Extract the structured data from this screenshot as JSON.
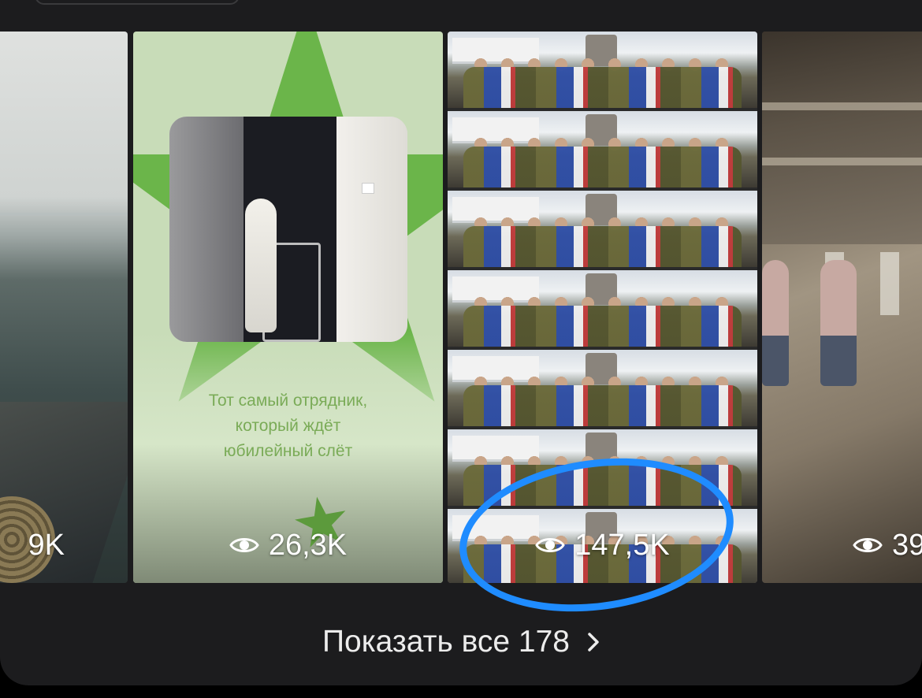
{
  "cards": [
    {
      "views": "9K"
    },
    {
      "views": "26,3K",
      "caption": "Тот самый отрядник,\nкоторый ждёт\nюбилейный слёт"
    },
    {
      "views": "147,5K"
    },
    {
      "views": "39"
    }
  ],
  "show_all": {
    "label": "Показать все 178"
  },
  "icons": {
    "views": "eye-icon",
    "next": "chevron-right-icon"
  },
  "colors": {
    "annotation": "#1f8cff",
    "caption_green": "#7aab57",
    "background": "#1c1c1e"
  }
}
